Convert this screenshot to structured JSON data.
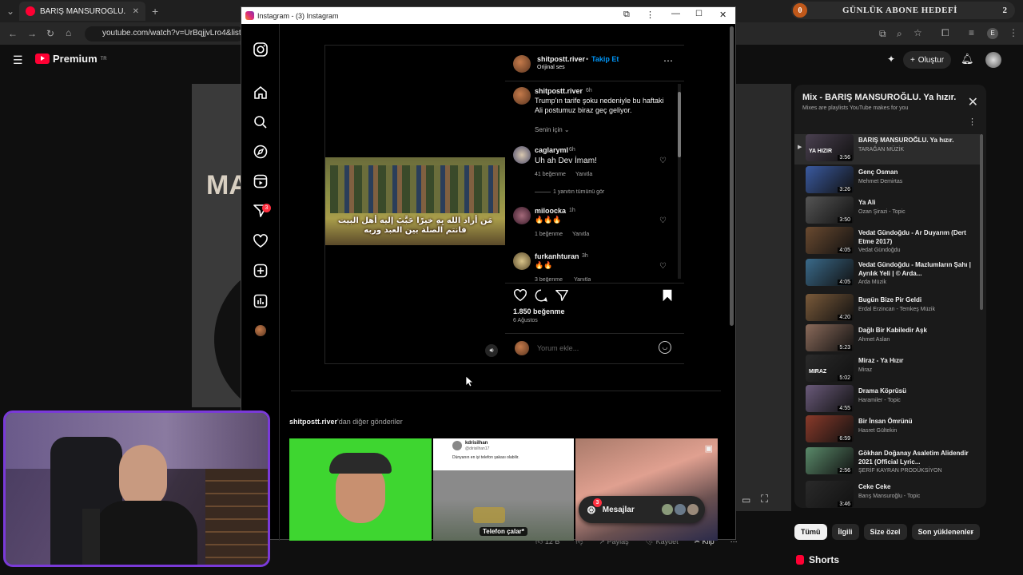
{
  "browser": {
    "tab_title": "BARIŞ MANSUROĞLU. Ya hızır.",
    "url": "youtube.com/watch?v=UrBqjjvLro4&list=F"
  },
  "youtube": {
    "logo_text": "Premium",
    "logo_region": "TR",
    "create_label": "Oluştur",
    "video_big_text": "MA",
    "actions": {
      "likes": "12 B",
      "share": "Paylaş",
      "save": "Kaydet",
      "clip": "Klip"
    },
    "playlist": {
      "title": "Mix - BARIŞ MANSUROĞLU. Ya hızır.",
      "subtitle": "Mixes are playlists YouTube makes for you",
      "items": [
        {
          "title": "BARIŞ MANSUROĞLU. Ya hızır.",
          "channel": "TARAĞAN MÜZİK",
          "duration": "3:56",
          "thumb_text": "YA HIZIR"
        },
        {
          "title": "Genç Osman",
          "channel": "Mehmet Demirtas",
          "duration": "3:26",
          "thumb_text": ""
        },
        {
          "title": "Ya Ali",
          "channel": "Ozan Şirazi - Topic",
          "duration": "3:50",
          "thumb_text": ""
        },
        {
          "title": "Vedat Gündoğdu - Ar Duyarım (Dert Etme 2017)",
          "channel": "Vedat Gündoğdu",
          "duration": "4:05",
          "thumb_text": ""
        },
        {
          "title": "Vedat Gündoğdu - Mazlumların Şahı | Ayrılık Yeli | © Arda...",
          "channel": "Arda Müzik",
          "duration": "4:05",
          "thumb_text": ""
        },
        {
          "title": "Bugün Bize Pir Geldi",
          "channel": "Erdal Erzincan - Temkeş Müzik",
          "duration": "4:20",
          "thumb_text": ""
        },
        {
          "title": "Dağlı Bir Kabiledir Aşk",
          "channel": "Ahmet Aslan",
          "duration": "5:23",
          "thumb_text": ""
        },
        {
          "title": "Miraz - Ya Hızır",
          "channel": "Miraz",
          "duration": "5:02",
          "thumb_text": "MIRAZ"
        },
        {
          "title": "Drama Köprüsü",
          "channel": "Haramiler - Topic",
          "duration": "4:55",
          "thumb_text": ""
        },
        {
          "title": "Bir İnsan Ömrünü",
          "channel": "Hasret Gültekin",
          "duration": "6:59",
          "thumb_text": ""
        },
        {
          "title": "Gökhan Doğanay Asaletim Alidendir 2021 (Official Lyric...",
          "channel": "ŞERİF KAYRAN PRODÜKSİYON",
          "duration": "2:56",
          "thumb_text": ""
        },
        {
          "title": "Ceke Ceke",
          "channel": "Barış Mansuroğlu - Topic",
          "duration": "3:46",
          "thumb_text": ""
        }
      ]
    },
    "chips": [
      "Tümü",
      "İlgili",
      "Size özel",
      "Son yüklenenler"
    ],
    "shorts_label": "Shorts"
  },
  "overlay": {
    "sub_count": "0",
    "goal_label": "GÜNLÜK ABONE HEDEFİ",
    "goal_value": "2"
  },
  "instagram": {
    "window_title": "Instagram - (3) Instagram",
    "notif_badge": "3",
    "post": {
      "username": "shitpostt.river",
      "follow_label": "Takip Et",
      "audio": "Orijinal ses",
      "caption_user": "shitpostt.river",
      "caption_time": "6h",
      "caption": "Trump'ın tarife şoku nedeniyle bu haftaki Ali postumuz biraz geç geliyor.",
      "for_you": "Senin için",
      "overlay_text_line1": "مَن أراد الله بِهِ خيرًا حَبَّبَ إليه أهل البيت",
      "overlay_text_line2": "فانتم الصلة بين العبد وربه",
      "comments": [
        {
          "user": "caglaryml",
          "time": "6h",
          "text": "Uh ah Dev İmam!",
          "likes": "41 beğenme",
          "reply": "Yanıtla",
          "view_replies": "1 yanıtın tümünü gör"
        },
        {
          "user": "miloocka",
          "time": "1h",
          "text": "🔥🔥🔥",
          "likes": "1 beğenme",
          "reply": "Yanıtla"
        },
        {
          "user": "furkanhturan",
          "time": "3h",
          "text": "🔥🔥",
          "likes": "3 beğenme",
          "reply": "Yanıtla"
        }
      ],
      "like_count": "1.850 beğenme",
      "date": "6 Ağustos",
      "comment_placeholder": "Yorum ekle..."
    },
    "more_posts_user": "shitpostt.river",
    "more_posts_suffix": "'dan diğer gönderiler",
    "tile2_name": "kdrisilhan",
    "tile2_handle": "@dirisilhan17",
    "tile2_text": "Dünyanın en iyi telefon şakası olabilir.",
    "tile2_caption": "Telefon çalar*",
    "messages_label": "Mesajlar",
    "messages_badge": "3"
  }
}
